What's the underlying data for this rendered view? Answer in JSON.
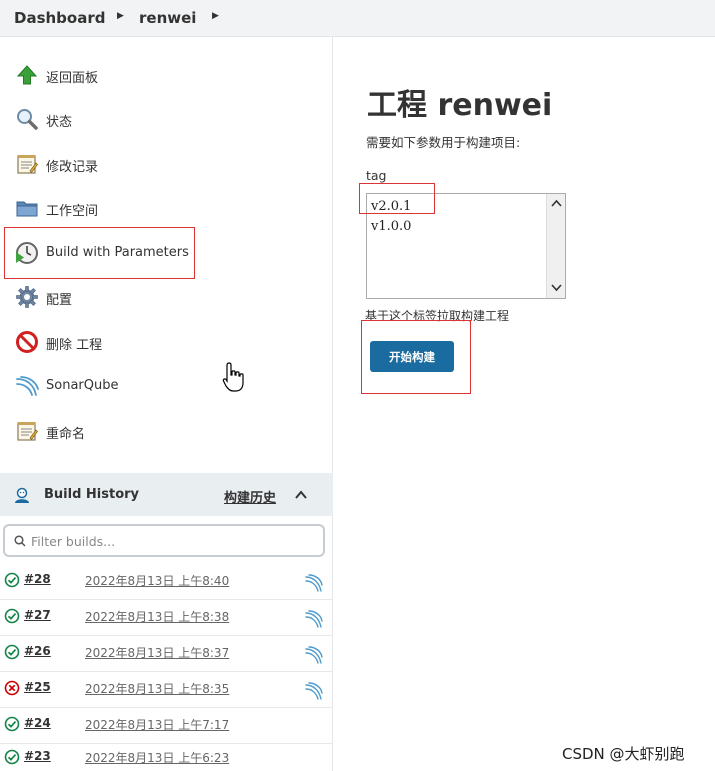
{
  "breadcrumb": {
    "items": [
      "Dashboard",
      "renwei"
    ]
  },
  "side_tasks": [
    {
      "label": "返回面板",
      "icon": "up-arrow-icon"
    },
    {
      "label": "状态",
      "icon": "search-icon"
    },
    {
      "label": "修改记录",
      "icon": "notepad-icon"
    },
    {
      "label": "工作空间",
      "icon": "folder-icon"
    },
    {
      "label": "Build with Parameters",
      "icon": "clock-play-icon"
    },
    {
      "label": "配置",
      "icon": "gear-icon"
    },
    {
      "label": "删除 工程",
      "icon": "no-entry-icon"
    },
    {
      "label": "SonarQube",
      "icon": "sonarqube-icon"
    },
    {
      "label": "重命名",
      "icon": "notepad-icon"
    }
  ],
  "build_history": {
    "title": "Build History",
    "trend_label": "构建历史",
    "filter_placeholder": "Filter builds...",
    "builds": [
      {
        "number": "#28",
        "date": "2022年8月13日 上午8:40",
        "status": "success",
        "sonar": true
      },
      {
        "number": "#27",
        "date": "2022年8月13日 上午8:38",
        "status": "success",
        "sonar": true
      },
      {
        "number": "#26",
        "date": "2022年8月13日 上午8:37",
        "status": "success",
        "sonar": true
      },
      {
        "number": "#25",
        "date": "2022年8月13日 上午8:35",
        "status": "failed",
        "sonar": true
      },
      {
        "number": "#24",
        "date": "2022年8月13日 上午7:17",
        "status": "success",
        "sonar": false
      },
      {
        "number": "#23",
        "date": "2022年8月13日 上午6:23",
        "status": "success",
        "sonar": false
      }
    ]
  },
  "main": {
    "title": "工程 renwei",
    "description": "需要如下参数用于构建项目:",
    "param_name": "tag",
    "param_options": [
      "v2.0.1",
      "v1.0.0"
    ],
    "param_help": "基于这个标签拉取构建工程",
    "build_button": "开始构建"
  },
  "watermark": "CSDN @大虾别跑",
  "colors": {
    "accent": "#1a6ba0",
    "success": "#138347",
    "failure": "#cc0003",
    "highlight_box": "#dd3333"
  }
}
